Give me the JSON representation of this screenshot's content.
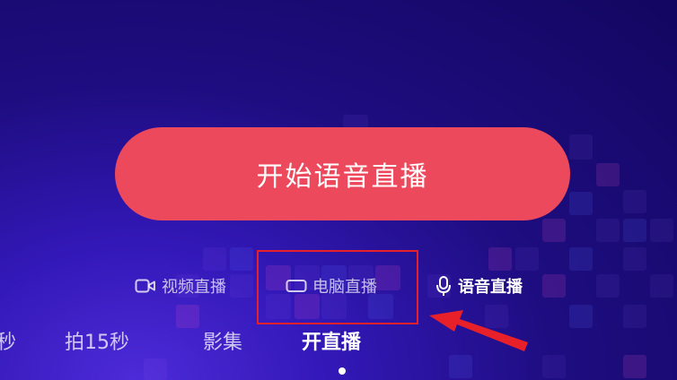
{
  "start_button": {
    "label": "开始语音直播"
  },
  "modes": [
    {
      "label": "视频直播",
      "icon": "video-camera-icon",
      "active": false
    },
    {
      "label": "电脑直播",
      "icon": "monitor-icon",
      "active": false
    },
    {
      "label": "语音直播",
      "icon": "microphone-icon",
      "active": true
    }
  ],
  "tabs": [
    {
      "label": "秒",
      "active": false
    },
    {
      "label": "拍15秒",
      "active": false
    },
    {
      "label": "影集",
      "active": false
    },
    {
      "label": "开直播",
      "active": true
    }
  ],
  "colors": {
    "primary_button": "#ec4a5c",
    "highlight": "#e8202a",
    "background": "#1e0d80"
  }
}
